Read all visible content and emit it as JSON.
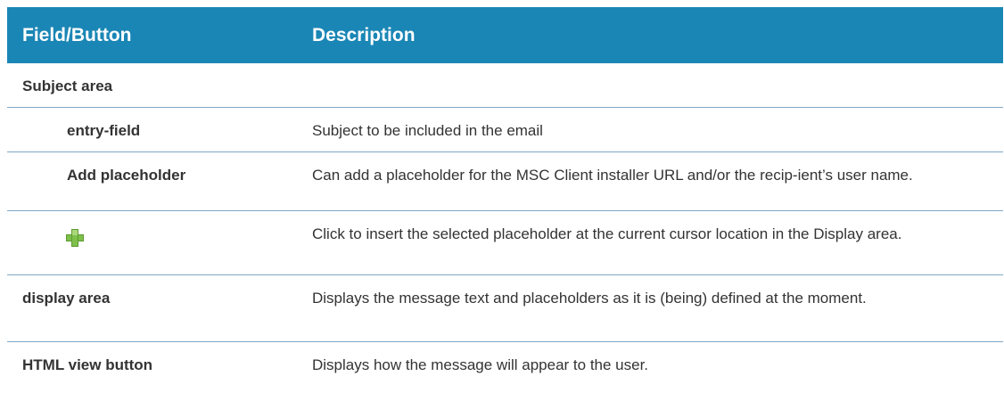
{
  "header": {
    "col1": "Field/Button",
    "col2": "Description"
  },
  "rows": [
    {
      "field": "Subject area",
      "description": ""
    },
    {
      "field": "entry-field",
      "description": "Subject to be included in the email"
    },
    {
      "field": "Add placeholder",
      "description": "Can add a placeholder for the MSC Client installer URL and/or the recip-ient’s user name."
    },
    {
      "field_icon": "plus-icon",
      "description": "Click to insert the selected placeholder at the current cursor location in the Display area."
    },
    {
      "field": "display area",
      "description": "Displays the message text and placeholders as it is (being) defined at the moment."
    },
    {
      "field": "HTML view button",
      "description": "Displays how the message will appear to the user."
    }
  ],
  "colors": {
    "header_bg": "#1a86b5",
    "divider": "#7fa8c7",
    "icon_green": "#7ec04a"
  }
}
